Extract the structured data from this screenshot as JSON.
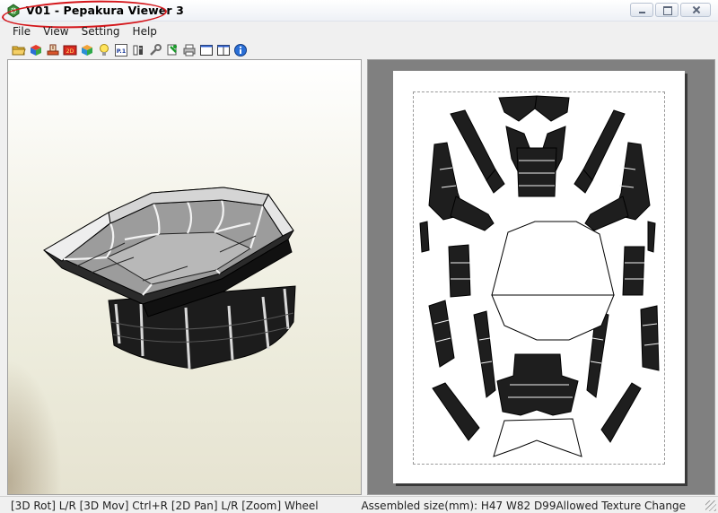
{
  "window": {
    "title": "V01 - Pepakura Viewer 3",
    "icon": "pepakura-app-icon"
  },
  "menu": {
    "items": [
      {
        "label": "File"
      },
      {
        "label": "View"
      },
      {
        "label": "Setting"
      },
      {
        "label": "Help"
      }
    ]
  },
  "toolbar": {
    "buttons": [
      {
        "icon": "open-folder-icon"
      },
      {
        "icon": "cube-texture-icon"
      },
      {
        "icon": "unfold-icon"
      },
      {
        "icon": "texture-icon"
      },
      {
        "icon": "cube-color-icon"
      },
      {
        "icon": "lightbulb-icon"
      },
      {
        "icon": "page-icon",
        "text": "P.1"
      },
      {
        "icon": "flip-icon"
      },
      {
        "icon": "wrench-icon"
      },
      {
        "icon": "print-preview-icon"
      },
      {
        "icon": "printer-icon"
      },
      {
        "icon": "window-single-icon"
      },
      {
        "icon": "window-split-icon"
      },
      {
        "icon": "info-icon"
      }
    ]
  },
  "status": {
    "left": "[3D Rot] L/R [3D Mov] Ctrl+R [2D Pan] L/R [Zoom] Wheel",
    "right": "Assembled size(mm): H47 W82 D99Allowed Texture Change"
  },
  "colors": {
    "part_fill": "#1e1e1e",
    "highlight_circle": "#d4161b",
    "paper": "#ffffff",
    "canvas_gray": "#808080"
  }
}
